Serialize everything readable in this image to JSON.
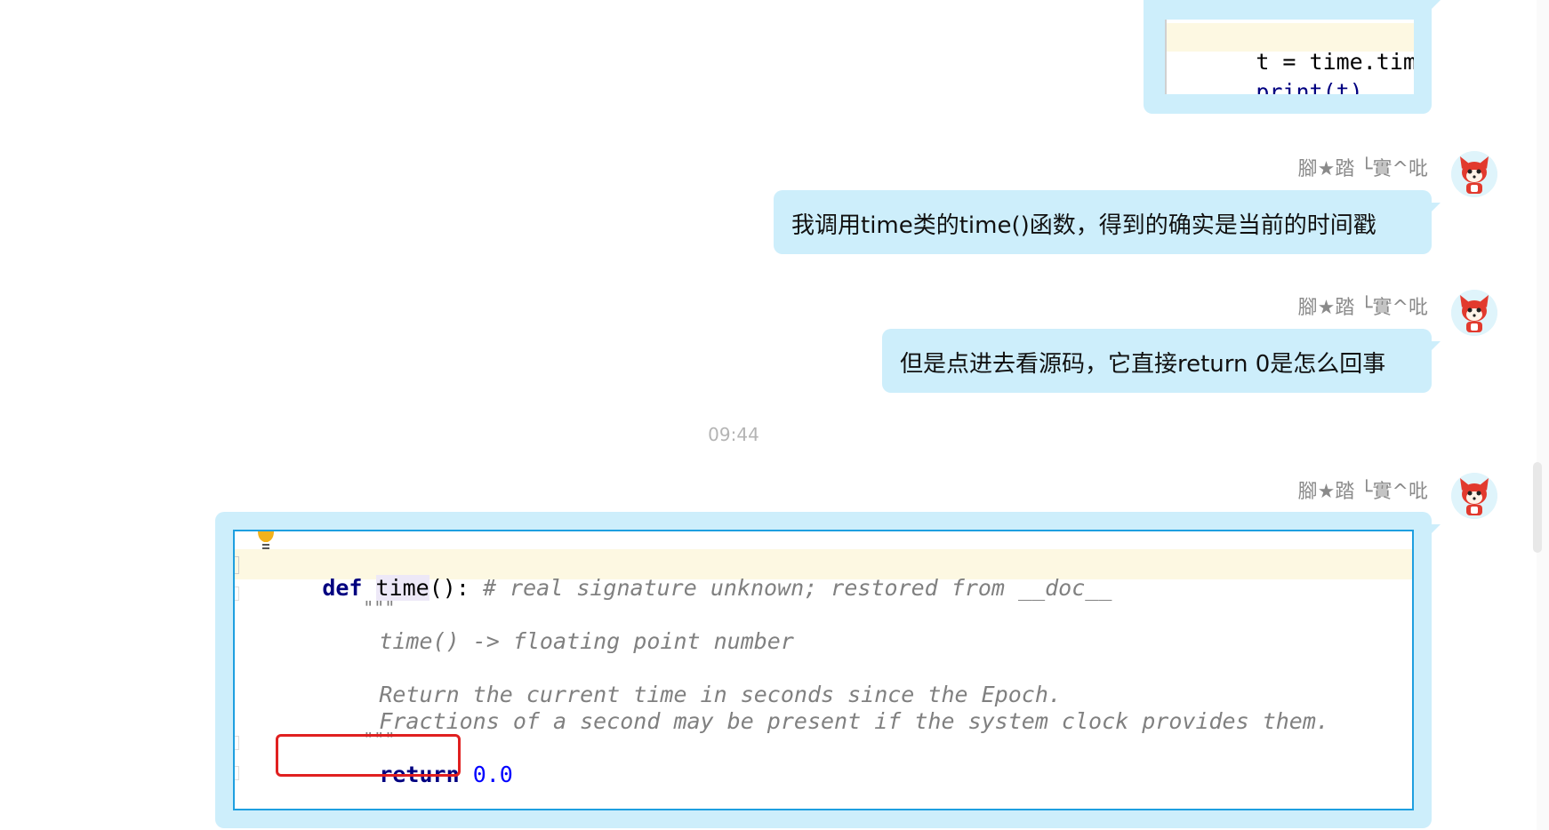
{
  "messages": [
    {
      "id": "code1",
      "type": "code",
      "lines": [
        "t = time.time()",
        "print(t)"
      ]
    },
    {
      "id": "m1",
      "sender": "腳★踏 └實^吡",
      "text": "我调用time类的time()函数，得到的确实是当前的时间戳"
    },
    {
      "id": "m2",
      "sender": "腳★踏 └實^吡",
      "text": "但是点进去看源码，它直接return 0是怎么回事"
    }
  ],
  "timestamp": "09:44",
  "code_message": {
    "sender": "腳★踏 └實^吡",
    "def_kw": "def",
    "fn_name": "time",
    "signature_rest": "():",
    "comment": "# real signature unknown; restored from __doc__",
    "docstring_open": "\"\"\"",
    "doc_line1": "time() -> floating point number",
    "doc_line2": "Return the current time in seconds since the Epoch.",
    "doc_line3": "Fractions of a second may be present if the system clock provides them.",
    "docstring_close": "\"\"\"",
    "return_kw": "return",
    "return_val": "0.0"
  },
  "colors": {
    "bubble": "#cdeefb",
    "highlight_box": "#e02020",
    "panel_border": "#1e9fe0"
  },
  "icons": {
    "avatar": "red-fox-avatar-icon",
    "bulb": "lightbulb-icon"
  }
}
